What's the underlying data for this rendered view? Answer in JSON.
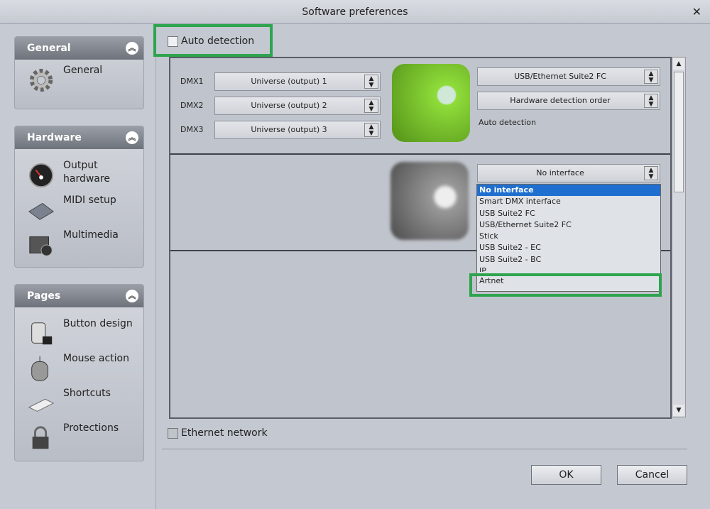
{
  "window": {
    "title": "Software preferences",
    "close_icon": "close-icon"
  },
  "sidebar": {
    "groups": [
      {
        "title": "General",
        "items": [
          {
            "label": "General",
            "icon": "gear-icon"
          }
        ]
      },
      {
        "title": "Hardware",
        "items": [
          {
            "label": "Output hardware",
            "icon": "gauge-icon"
          },
          {
            "label": "MIDI setup",
            "icon": "midi-keyboard-icon"
          },
          {
            "label": "Multimedia",
            "icon": "multimedia-folder-icon"
          }
        ]
      },
      {
        "title": "Pages",
        "items": [
          {
            "label": "Button design",
            "icon": "button-design-icon"
          },
          {
            "label": "Mouse action",
            "icon": "mouse-icon"
          },
          {
            "label": "Shortcuts",
            "icon": "keyboard-icon"
          },
          {
            "label": "Protections",
            "icon": "padlock-icon"
          }
        ]
      }
    ]
  },
  "main": {
    "auto_detection_label": "Auto detection",
    "auto_detection_checked": false,
    "interface1": {
      "dmx": [
        {
          "label": "DMX1",
          "value": "Universe (output) 1"
        },
        {
          "label": "DMX2",
          "value": "Universe (output) 2"
        },
        {
          "label": "DMX3",
          "value": "Universe (output) 3"
        }
      ],
      "device": "USB/Ethernet Suite2 FC",
      "detection": "Hardware detection order",
      "status": "Auto detection"
    },
    "interface2": {
      "device": "No interface",
      "options": [
        "No interface",
        "Smart DMX interface",
        "USB Suite2 FC",
        "USB/Ethernet Suite2 FC",
        "Stick",
        "USB Suite2 - EC",
        "USB Suite2 - BC",
        "IP",
        "Artnet"
      ],
      "highlighted": "No interface"
    },
    "ethernet_label": "Ethernet network",
    "ethernet_checked": false,
    "ok_label": "OK",
    "cancel_label": "Cancel",
    "highlight_color": "#2ea44f"
  }
}
